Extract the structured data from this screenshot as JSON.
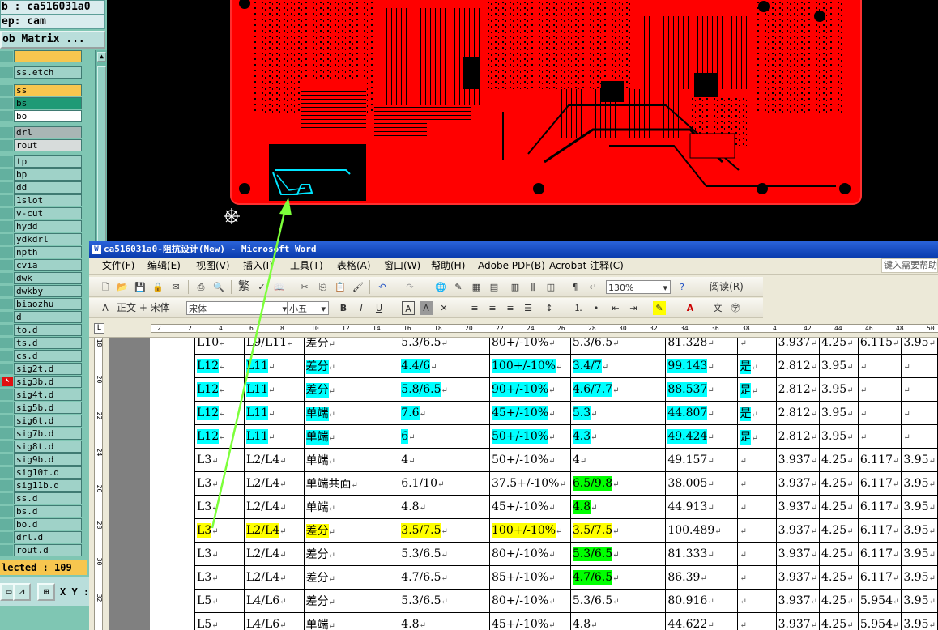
{
  "cam": {
    "job_label": "b : ca516031a0",
    "step_label": "ep: cam",
    "matrix_button": "ob Matrix ...",
    "layers": [
      {
        "name": "",
        "color": "orange",
        "mark": ""
      },
      {
        "name": "ss.etch",
        "color": "default",
        "mark": ""
      },
      {
        "name": "ss",
        "color": "orange",
        "mark": "✎"
      },
      {
        "name": "bs",
        "color": "green",
        "mark": ""
      },
      {
        "name": "bo",
        "color": "white",
        "mark": "✎"
      },
      {
        "name": "drl",
        "color": "gray",
        "mark": ""
      },
      {
        "name": "rout",
        "color": "lgray",
        "mark": ""
      },
      {
        "name": "tp",
        "color": "default",
        "mark": ""
      },
      {
        "name": "bp",
        "color": "default",
        "mark": ""
      },
      {
        "name": "dd",
        "color": "default",
        "mark": ""
      },
      {
        "name": "1slot",
        "color": "default",
        "mark": ""
      },
      {
        "name": "v-cut",
        "color": "default",
        "mark": ""
      },
      {
        "name": "hydd",
        "color": "default",
        "mark": ""
      },
      {
        "name": "ydkdrl",
        "color": "default",
        "mark": ""
      },
      {
        "name": "npth",
        "color": "default",
        "mark": ""
      },
      {
        "name": "cvia",
        "color": "default",
        "mark": ""
      },
      {
        "name": "dwk",
        "color": "default",
        "mark": ""
      },
      {
        "name": "dwkby",
        "color": "default",
        "mark": ""
      },
      {
        "name": "biaozhu",
        "color": "default",
        "mark": ""
      },
      {
        "name": "d",
        "color": "default",
        "mark": ""
      },
      {
        "name": "to.d",
        "color": "default",
        "mark": "✎"
      },
      {
        "name": "ts.d",
        "color": "default",
        "mark": ""
      },
      {
        "name": "cs.d",
        "color": "default",
        "mark": "✎"
      },
      {
        "name": "sig2t.d",
        "color": "default",
        "mark": ""
      },
      {
        "name": "sig3b.d",
        "color": "default",
        "mark": "▦"
      },
      {
        "name": "sig4t.d",
        "color": "default",
        "mark": ""
      },
      {
        "name": "sig5b.d",
        "color": "default",
        "mark": ""
      },
      {
        "name": "sig6t.d",
        "color": "default",
        "mark": ""
      },
      {
        "name": "sig7b.d",
        "color": "default",
        "mark": ""
      },
      {
        "name": "sig8t.d",
        "color": "default",
        "mark": ""
      },
      {
        "name": "sig9b.d",
        "color": "default",
        "mark": ""
      },
      {
        "name": "sig10t.d",
        "color": "default",
        "mark": ""
      },
      {
        "name": "sig11b.d",
        "color": "default",
        "mark": ""
      },
      {
        "name": "ss.d",
        "color": "default",
        "mark": "✎"
      },
      {
        "name": "bs.d",
        "color": "default",
        "mark": ""
      },
      {
        "name": "bo.d",
        "color": "default",
        "mark": "✎"
      },
      {
        "name": "drl.d",
        "color": "default",
        "mark": ""
      },
      {
        "name": "rout.d",
        "color": "default",
        "mark": ""
      }
    ],
    "selected_label": "lected : 109",
    "xy_label": "X Y :"
  },
  "word": {
    "title": "ca516031a0-阻抗设计(New) - Microsoft Word",
    "menu": [
      "文件(F)",
      "编辑(E)",
      "视图(V)",
      "插入(I)",
      "工具(T)",
      "表格(A)",
      "窗口(W)",
      "帮助(H)",
      "Adobe PDF(B)",
      "Acrobat 注释(C)"
    ],
    "help_box": "键入需要帮助",
    "zoom": "130%",
    "read_label": "阅读(R)",
    "style_value": "正文 + 宋体",
    "font_value": "宋体",
    "size_value": "小五",
    "ruler_numbers": [
      "2",
      "2",
      "4",
      "6",
      "8",
      "10",
      "12",
      "14",
      "16",
      "18",
      "20",
      "22",
      "24",
      "26",
      "28",
      "30",
      "32",
      "34",
      "36",
      "38",
      "4",
      "42",
      "44",
      "46",
      "48",
      "50"
    ],
    "vruler_numbers": [
      "18",
      "20",
      "22",
      "24",
      "26",
      "28",
      "30",
      "32"
    ],
    "table_rows": [
      [
        {
          "t": "L10"
        },
        {
          "t": "L9/L11"
        },
        {
          "t": "差分"
        },
        {
          "t": "5.3/6.5"
        },
        {
          "t": "80+/-10%"
        },
        {
          "t": "5.3/6.5"
        },
        {
          "t": "81.328"
        },
        {
          "t": ""
        },
        {
          "t": "3.937"
        },
        {
          "t": "4.25"
        },
        {
          "t": "6.115"
        },
        {
          "t": "3.95"
        }
      ],
      [
        {
          "t": "L12",
          "h": "cyan"
        },
        {
          "t": "L11",
          "h": "cyan"
        },
        {
          "t": "差分",
          "h": "cyan"
        },
        {
          "t": "4.4/6",
          "h": "cyan"
        },
        {
          "t": "100+/-10%",
          "h": "cyan"
        },
        {
          "t": "3.4/7",
          "h": "cyan"
        },
        {
          "t": "99.143",
          "h": "cyan"
        },
        {
          "t": "是",
          "h": "cyan"
        },
        {
          "t": "2.812"
        },
        {
          "t": "3.95"
        },
        {
          "t": ""
        },
        {
          "t": ""
        }
      ],
      [
        {
          "t": "L12",
          "h": "cyan"
        },
        {
          "t": "L11",
          "h": "cyan"
        },
        {
          "t": "差分",
          "h": "cyan"
        },
        {
          "t": "5.8/6.5",
          "h": "cyan"
        },
        {
          "t": "90+/-10%",
          "h": "cyan"
        },
        {
          "t": "4.6/7.7",
          "h": "cyan"
        },
        {
          "t": "88.537",
          "h": "cyan"
        },
        {
          "t": "是",
          "h": "cyan"
        },
        {
          "t": "2.812"
        },
        {
          "t": "3.95"
        },
        {
          "t": ""
        },
        {
          "t": ""
        }
      ],
      [
        {
          "t": "L12",
          "h": "cyan"
        },
        {
          "t": "L11",
          "h": "cyan"
        },
        {
          "t": "单端",
          "h": "cyan"
        },
        {
          "t": "7.6",
          "h": "cyan"
        },
        {
          "t": "45+/-10%",
          "h": "cyan"
        },
        {
          "t": "5.3",
          "h": "cyan"
        },
        {
          "t": "44.807",
          "h": "cyan"
        },
        {
          "t": "是",
          "h": "cyan"
        },
        {
          "t": "2.812"
        },
        {
          "t": "3.95"
        },
        {
          "t": ""
        },
        {
          "t": ""
        }
      ],
      [
        {
          "t": "L12",
          "h": "cyan"
        },
        {
          "t": "L11",
          "h": "cyan"
        },
        {
          "t": "单端",
          "h": "cyan"
        },
        {
          "t": "6",
          "h": "cyan"
        },
        {
          "t": "50+/-10%",
          "h": "cyan"
        },
        {
          "t": "4.3",
          "h": "cyan"
        },
        {
          "t": "49.424",
          "h": "cyan"
        },
        {
          "t": "是",
          "h": "cyan"
        },
        {
          "t": "2.812"
        },
        {
          "t": "3.95"
        },
        {
          "t": ""
        },
        {
          "t": ""
        }
      ],
      [
        {
          "t": "L3"
        },
        {
          "t": "L2/L4"
        },
        {
          "t": "单端"
        },
        {
          "t": "4"
        },
        {
          "t": "50+/-10%"
        },
        {
          "t": "4"
        },
        {
          "t": "49.157"
        },
        {
          "t": ""
        },
        {
          "t": "3.937"
        },
        {
          "t": "4.25"
        },
        {
          "t": "6.117"
        },
        {
          "t": "3.95"
        }
      ],
      [
        {
          "t": "L3"
        },
        {
          "t": "L2/L4"
        },
        {
          "t": "单端共面"
        },
        {
          "t": "6.1/10"
        },
        {
          "t": "37.5+/-10%"
        },
        {
          "t": "6.5/9.8",
          "h": "green"
        },
        {
          "t": "38.005"
        },
        {
          "t": ""
        },
        {
          "t": "3.937"
        },
        {
          "t": "4.25"
        },
        {
          "t": "6.117"
        },
        {
          "t": "3.95"
        }
      ],
      [
        {
          "t": "L3"
        },
        {
          "t": "L2/L4"
        },
        {
          "t": "单端"
        },
        {
          "t": "4.8"
        },
        {
          "t": "45+/-10%"
        },
        {
          "t": "4.8",
          "h": "green"
        },
        {
          "t": "44.913"
        },
        {
          "t": ""
        },
        {
          "t": "3.937"
        },
        {
          "t": "4.25"
        },
        {
          "t": "6.117"
        },
        {
          "t": "3.95"
        }
      ],
      [
        {
          "t": "L3",
          "h": "yellow"
        },
        {
          "t": "L2/L4",
          "h": "yellow"
        },
        {
          "t": "差分",
          "h": "yellow"
        },
        {
          "t": "3.5/7.5",
          "h": "yellow"
        },
        {
          "t": "100+/-10%",
          "h": "yellow"
        },
        {
          "t": "3.5/7.5",
          "h": "yellow"
        },
        {
          "t": "100.489"
        },
        {
          "t": ""
        },
        {
          "t": "3.937"
        },
        {
          "t": "4.25"
        },
        {
          "t": "6.117"
        },
        {
          "t": "3.95"
        }
      ],
      [
        {
          "t": "L3"
        },
        {
          "t": "L2/L4"
        },
        {
          "t": "差分"
        },
        {
          "t": "5.3/6.5"
        },
        {
          "t": "80+/-10%"
        },
        {
          "t": "5.3/6.5",
          "h": "green"
        },
        {
          "t": "81.333"
        },
        {
          "t": ""
        },
        {
          "t": "3.937"
        },
        {
          "t": "4.25"
        },
        {
          "t": "6.117"
        },
        {
          "t": "3.95"
        }
      ],
      [
        {
          "t": "L3"
        },
        {
          "t": "L2/L4"
        },
        {
          "t": "差分"
        },
        {
          "t": "4.7/6.5"
        },
        {
          "t": "85+/-10%"
        },
        {
          "t": "4.7/6.5",
          "h": "green"
        },
        {
          "t": "86.39"
        },
        {
          "t": ""
        },
        {
          "t": "3.937"
        },
        {
          "t": "4.25"
        },
        {
          "t": "6.117"
        },
        {
          "t": "3.95"
        }
      ],
      [
        {
          "t": "L5"
        },
        {
          "t": "L4/L6"
        },
        {
          "t": "差分"
        },
        {
          "t": "5.3/6.5"
        },
        {
          "t": "80+/-10%"
        },
        {
          "t": "5.3/6.5"
        },
        {
          "t": "80.916"
        },
        {
          "t": ""
        },
        {
          "t": "3.937"
        },
        {
          "t": "4.25"
        },
        {
          "t": "5.954"
        },
        {
          "t": "3.95"
        }
      ],
      [
        {
          "t": "L5"
        },
        {
          "t": "L4/L6"
        },
        {
          "t": "单端"
        },
        {
          "t": "4.8"
        },
        {
          "t": "45+/-10%"
        },
        {
          "t": "4.8"
        },
        {
          "t": "44.622"
        },
        {
          "t": ""
        },
        {
          "t": "3.937"
        },
        {
          "t": "4.25"
        },
        {
          "t": "5.954"
        },
        {
          "t": "3.95"
        }
      ]
    ]
  },
  "colors": {
    "pcb_copper": "#ff0000",
    "pcb_background": "#000000",
    "highlight_trace": "#00e5ff",
    "arrow": "#7cff3a",
    "cam_panel": "#7fc6b3",
    "word_title": "#0a3cae"
  }
}
